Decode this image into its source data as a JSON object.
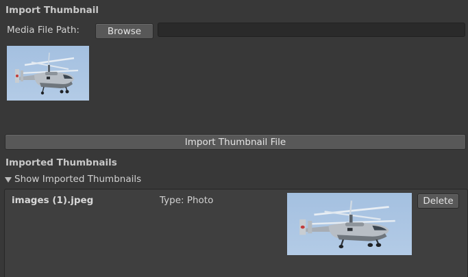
{
  "import_section": {
    "title": "Import Thumbnail",
    "media_path_label": "Media File Path:",
    "browse_label": "Browse",
    "path_value": "",
    "thumbnail_icon": "helicopter-photo",
    "import_button_label": "Import Thumbnail File"
  },
  "imported_section": {
    "title": "Imported Thumbnails",
    "foldout_label": "Show Imported Thumbnails",
    "foldout_expanded": true,
    "items": [
      {
        "name": "images (1).jpeg",
        "type_label": "Type: Photo",
        "thumbnail_icon": "helicopter-photo",
        "delete_label": "Delete"
      }
    ]
  },
  "colors": {
    "background": "#383838",
    "button": "#585858",
    "field": "#2a2a2a",
    "sky": "#a9c4e2"
  }
}
